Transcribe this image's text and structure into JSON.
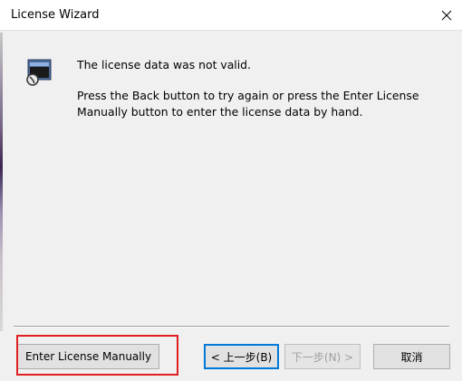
{
  "window": {
    "title": "License Wizard"
  },
  "icons": {
    "close": "close-icon",
    "app": "license-wizard-icon"
  },
  "message": {
    "line1": "The license data was not valid.",
    "line2": "Press the Back button to try again or press the Enter License Manually button to enter the license data by hand."
  },
  "buttons": {
    "enter_manually": "Enter License Manually",
    "back": "< 上一步(B)",
    "next": "下一步(N) >",
    "cancel": "取消"
  },
  "colors": {
    "highlight": "#e02020",
    "focus_border": "#0078d7"
  }
}
